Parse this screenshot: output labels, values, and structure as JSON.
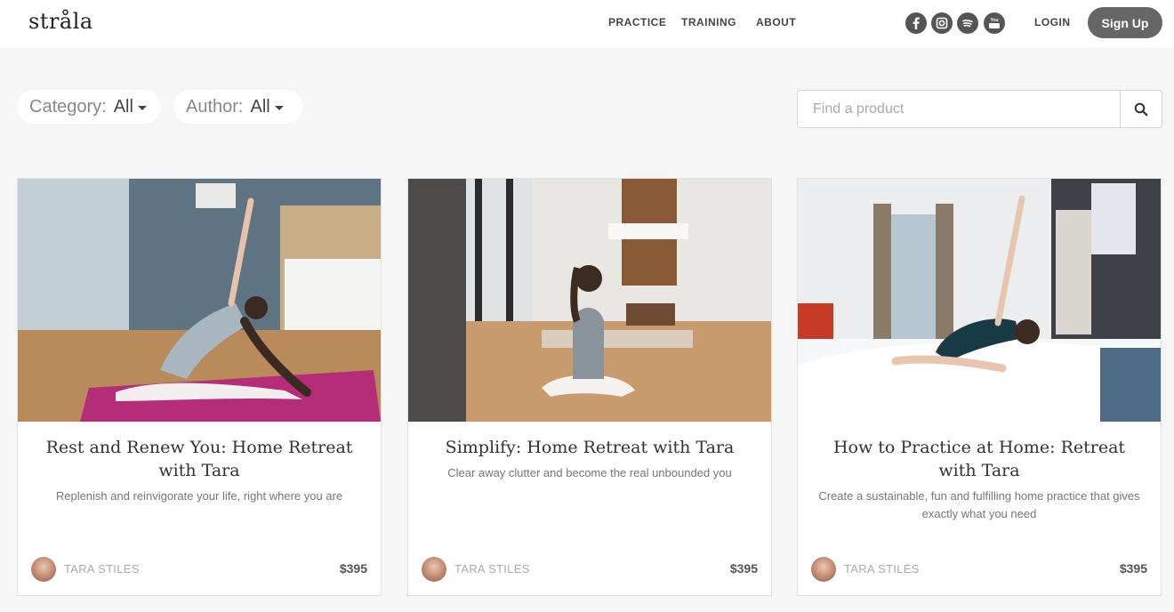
{
  "header": {
    "logo": "stråla",
    "nav": [
      "PRACTICE",
      "TRAINING",
      "ABOUT"
    ],
    "social_icons": [
      "facebook-icon",
      "instagram-icon",
      "spotify-icon",
      "youtube-icon"
    ],
    "login": "LOGIN",
    "signup": "Sign Up"
  },
  "filters": {
    "category_label": "Category:",
    "category_value": "All",
    "author_label": "Author:",
    "author_value": "All"
  },
  "search": {
    "placeholder": "Find a product",
    "icon": "search-icon"
  },
  "products": [
    {
      "title": "Rest and Renew You: Home Retreat with Tara",
      "description": "Replenish and reinvigorate your life, right where you are",
      "author": "TARA STILES",
      "price": "$395"
    },
    {
      "title": "Simplify: Home Retreat with Tara",
      "description": "Clear away clutter and become the real unbounded you",
      "author": "TARA STILES",
      "price": "$395"
    },
    {
      "title": "How to Practice at Home: Retreat with Tara",
      "description": "Create a sustainable, fun and fulfilling home practice that gives exactly what you need",
      "author": "TARA STILES",
      "price": "$395"
    }
  ],
  "colors": {
    "page_bg": "#f6f6f6",
    "signup_bg": "#666666",
    "social_icon_bg": "#555555"
  }
}
